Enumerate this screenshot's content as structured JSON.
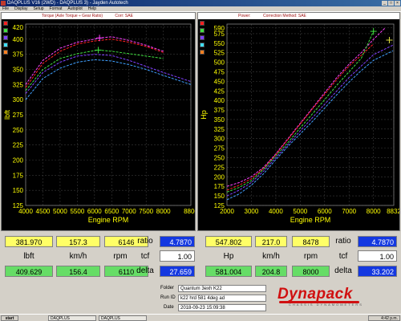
{
  "window": {
    "title": "DAQPLUS V16 (2WD) - DAQPLUS 3) - Jayden Autotech"
  },
  "menu": [
    "File",
    "Display",
    "Setup",
    "Format",
    "Autoplot",
    "Help"
  ],
  "swatch_colors": [
    "#ff2020",
    "#40e040",
    "#8040ff",
    "#40e0ff",
    "#ff8020"
  ],
  "left_chart": {
    "header": {
      "title": "Torque (Axle Torque ÷ Gear Ratio)",
      "corr": "Corr: SAE"
    }
  },
  "right_chart": {
    "header": {
      "title": "Power:",
      "corr": "Correction Method: SAE"
    }
  },
  "chart_data": [
    {
      "type": "line",
      "ylabel": "lbft",
      "xlabel": "Engine RPM",
      "xlim": [
        4000,
        8800
      ],
      "ylim": [
        125,
        425
      ],
      "x_ticks": [
        4000,
        4500,
        5000,
        5500,
        6000,
        6500,
        7000,
        7500,
        8000,
        8800
      ],
      "y_ticks": [
        125,
        150,
        175,
        200,
        225,
        250,
        275,
        300,
        325,
        350,
        375,
        400,
        420
      ],
      "grid": true,
      "series": [
        {
          "color": "#ff40ff",
          "x": [
            4000,
            4500,
            5000,
            5500,
            6000,
            6146,
            6500,
            7000,
            7500,
            8000
          ],
          "y": [
            325,
            365,
            385,
            395,
            400,
            402,
            404,
            398,
            390,
            380
          ]
        },
        {
          "color": "#ff2020",
          "x": [
            4000,
            4500,
            5000,
            5500,
            6000,
            6500,
            7000,
            7500,
            8000
          ],
          "y": [
            320,
            360,
            380,
            392,
            397,
            400,
            395,
            388,
            378
          ]
        },
        {
          "color": "#40e040",
          "x": [
            4000,
            4500,
            5000,
            5500,
            6000,
            6110,
            6500,
            7000,
            7500,
            8000
          ],
          "y": [
            315,
            350,
            368,
            376,
            381,
            382,
            380,
            376,
            372,
            368
          ]
        },
        {
          "color": "#8040ff",
          "x": [
            4000,
            4500,
            5000,
            5500,
            6000,
            6500,
            7000,
            7500,
            8000,
            8800
          ],
          "y": [
            310,
            345,
            362,
            372,
            375,
            373,
            365,
            355,
            345,
            330
          ]
        },
        {
          "color": "#40a0ff",
          "x": [
            4000,
            4500,
            5000,
            5500,
            6000,
            6500,
            7000,
            7500,
            8000,
            8800
          ],
          "y": [
            300,
            335,
            352,
            362,
            366,
            364,
            358,
            350,
            340,
            325
          ]
        }
      ],
      "markers": [
        {
          "color": "#ff40ff",
          "x": 6146,
          "y": 402
        },
        {
          "color": "#40e040",
          "x": 6110,
          "y": 382
        }
      ]
    },
    {
      "type": "line",
      "ylabel": "Hp",
      "xlabel": "Engine RPM",
      "xlim": [
        2000,
        8832
      ],
      "ylim": [
        125,
        600
      ],
      "x_ticks": [
        2000,
        3000,
        4000,
        5000,
        6000,
        7000,
        8000,
        8832
      ],
      "y_ticks": [
        125,
        150,
        175,
        200,
        225,
        250,
        275,
        300,
        325,
        350,
        375,
        400,
        425,
        450,
        475,
        500,
        525,
        550,
        575,
        590
      ],
      "grid": true,
      "series": [
        {
          "color": "#ff40ff",
          "x": [
            2000,
            2500,
            3000,
            3500,
            4000,
            4500,
            5000,
            5500,
            6000,
            6500,
            7000,
            7500,
            8000,
            8478
          ],
          "y": [
            175,
            185,
            200,
            225,
            260,
            300,
            340,
            380,
            420,
            460,
            495,
            525,
            560,
            590
          ]
        },
        {
          "color": "#ff2020",
          "x": [
            2000,
            2500,
            3000,
            3500,
            4000,
            4500,
            5000,
            5500,
            6000,
            6500,
            7000,
            7500,
            8000
          ],
          "y": [
            165,
            178,
            195,
            222,
            258,
            298,
            338,
            378,
            416,
            455,
            490,
            518,
            548
          ]
        },
        {
          "color": "#40e040",
          "x": [
            2000,
            2500,
            3000,
            3500,
            4000,
            4500,
            5000,
            5500,
            6000,
            6500,
            7000,
            7500,
            8000
          ],
          "y": [
            160,
            172,
            190,
            220,
            255,
            290,
            328,
            365,
            402,
            440,
            475,
            510,
            581
          ]
        },
        {
          "color": "#8040ff",
          "x": [
            2000,
            2500,
            3000,
            3500,
            4000,
            4500,
            5000,
            5500,
            6000,
            6500,
            7000,
            7500,
            8000,
            8800
          ],
          "y": [
            150,
            165,
            185,
            215,
            250,
            285,
            320,
            355,
            390,
            425,
            460,
            490,
            520,
            545
          ]
        },
        {
          "color": "#40a0ff",
          "x": [
            2000,
            2500,
            3000,
            3500,
            4000,
            4500,
            5000,
            5500,
            6000,
            6500,
            7000,
            7500,
            8000,
            8800
          ],
          "y": [
            140,
            155,
            178,
            208,
            245,
            280,
            312,
            345,
            380,
            415,
            448,
            478,
            505,
            530
          ]
        }
      ],
      "markers": [
        {
          "color": "#40e040",
          "x": 8000,
          "y": 581
        },
        {
          "color": "#e0e040",
          "x": 8650,
          "y": 558
        }
      ]
    }
  ],
  "readouts": {
    "left": {
      "row1": {
        "value": "381.970",
        "speed": "157.3",
        "rpm": "6146",
        "ratio_label": "ratio",
        "ratio": "4.7870"
      },
      "row2": {
        "unit": "lbft",
        "speed_unit": "km/h",
        "rpm_unit": "rpm",
        "tcf_label": "tcf",
        "tcf": "1.00"
      },
      "row3": {
        "value": "409.629",
        "speed": "156.4",
        "rpm": "6110",
        "delta_label": "delta",
        "delta": "27.659"
      }
    },
    "right": {
      "row1": {
        "value": "547.802",
        "speed": "217.0",
        "rpm": "8478",
        "ratio_label": "ratio",
        "ratio": "4.7870"
      },
      "row2": {
        "unit": "Hp",
        "speed_unit": "km/h",
        "rpm_unit": "rpm",
        "tcf_label": "tcf",
        "tcf": "1.00"
      },
      "row3": {
        "value": "581.004",
        "speed": "204.8",
        "rpm": "8000",
        "delta_label": "delta",
        "delta": "33.202"
      }
    }
  },
  "info": {
    "folder_label": "Folder",
    "folder": "Quantum 3exh K22",
    "runid_label": "Run ID",
    "runid": "k22 hrd 581 4deg ad",
    "date_label": "Date",
    "date": "2018-09-23 15:09:38"
  },
  "logo": {
    "word": "Dynapack",
    "tag": "CHASSIS DYNAMOMETERS"
  },
  "taskbar": {
    "start": "start",
    "tasks": [
      "DAQPLUS",
      "DAQPLUS"
    ],
    "clock": "4:42 p.m."
  }
}
